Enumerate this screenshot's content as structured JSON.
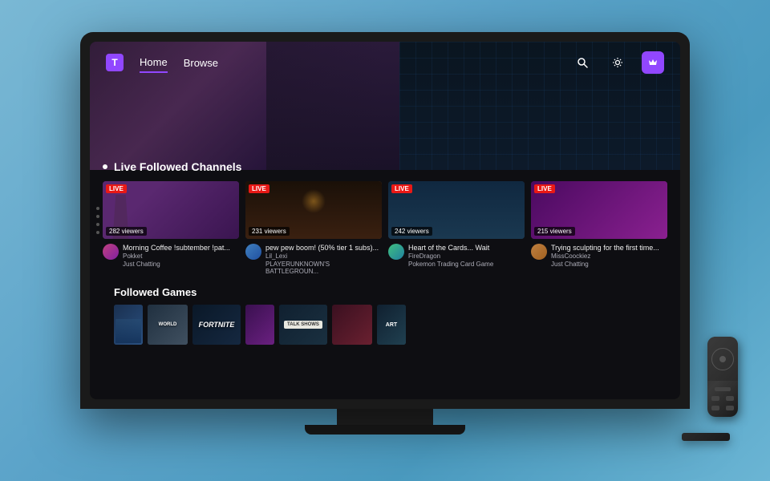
{
  "background": {
    "color_start": "#7ab8d4",
    "color_end": "#4a9abf"
  },
  "nav": {
    "logo_label": "T",
    "items": [
      {
        "label": "Home",
        "active": true
      },
      {
        "label": "Browse",
        "active": false
      }
    ],
    "icons": {
      "search": "🔍",
      "settings": "⚙",
      "crown": "✦"
    }
  },
  "sections": {
    "live_followed": {
      "title": "Live Followed Channels",
      "channels": [
        {
          "stream_title": "Morning Coffee !subtember !pat...",
          "name": "Pokket",
          "game": "Just Chatting",
          "viewers": "282 viewers"
        },
        {
          "stream_title": "pew pew boom! (50% tier 1 subs)...",
          "name": "Lil_Lexi",
          "game": "PLAYERUNKNOWN'S BATTLEGROUN...",
          "viewers": "231 viewers"
        },
        {
          "stream_title": "Heart of the Cards... Wait",
          "name": "FireDragon",
          "game": "Pokemon Trading Card Game",
          "viewers": "242 viewers"
        },
        {
          "stream_title": "Trying sculpting for the first time...",
          "name": "MissCoockiez",
          "game": "Just Chatting",
          "viewers": "215 viewers"
        }
      ]
    },
    "followed_games": {
      "title": "Followed Games",
      "games": [
        {
          "label": "",
          "style": "dark-blue"
        },
        {
          "label": "WORLD",
          "style": "dark"
        },
        {
          "label": "FORTNITE",
          "style": "dark-fortnite"
        },
        {
          "label": "",
          "style": "purple"
        },
        {
          "label": "TALK SHOWS",
          "style": "badge"
        },
        {
          "label": "",
          "style": "dark-red"
        },
        {
          "label": "ART",
          "style": "dark-teal"
        }
      ]
    }
  }
}
